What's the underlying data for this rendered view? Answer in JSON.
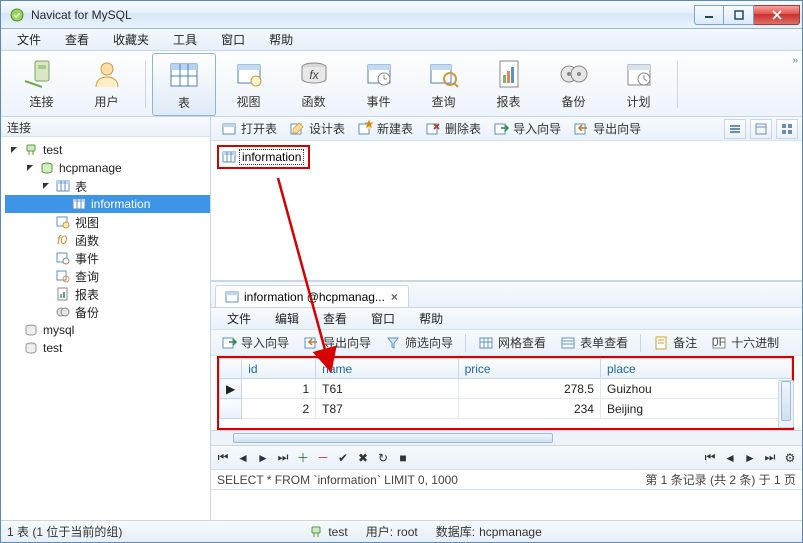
{
  "window": {
    "title": "Navicat for MySQL"
  },
  "menu": {
    "items": [
      "文件",
      "查看",
      "收藏夹",
      "工具",
      "窗口",
      "帮助"
    ]
  },
  "main_toolbar": {
    "items": [
      {
        "id": "connect",
        "label": "连接"
      },
      {
        "id": "user",
        "label": "用户"
      },
      {
        "id": "table",
        "label": "表",
        "selected": true
      },
      {
        "id": "view",
        "label": "视图"
      },
      {
        "id": "function",
        "label": "函数"
      },
      {
        "id": "event",
        "label": "事件"
      },
      {
        "id": "query",
        "label": "查询"
      },
      {
        "id": "report",
        "label": "报表"
      },
      {
        "id": "backup",
        "label": "备份"
      },
      {
        "id": "schedule",
        "label": "计划"
      }
    ]
  },
  "conn_panel": {
    "header": "连接"
  },
  "tree": {
    "nodes": [
      {
        "depth": 0,
        "arrow": "open",
        "icon": "plug-green",
        "label": "test"
      },
      {
        "depth": 1,
        "arrow": "open",
        "icon": "db-green",
        "label": "hcpmanage"
      },
      {
        "depth": 2,
        "arrow": "open",
        "icon": "table",
        "label": "表"
      },
      {
        "depth": 3,
        "arrow": "none",
        "icon": "table",
        "label": "information",
        "selected": true
      },
      {
        "depth": 2,
        "arrow": "none",
        "icon": "view",
        "label": "视图"
      },
      {
        "depth": 2,
        "arrow": "none",
        "icon": "fn",
        "label": "函数"
      },
      {
        "depth": 2,
        "arrow": "none",
        "icon": "event",
        "label": "事件"
      },
      {
        "depth": 2,
        "arrow": "none",
        "icon": "query",
        "label": "查询"
      },
      {
        "depth": 2,
        "arrow": "none",
        "icon": "report",
        "label": "报表"
      },
      {
        "depth": 2,
        "arrow": "none",
        "icon": "backup",
        "label": "备份"
      },
      {
        "depth": 0,
        "arrow": "none",
        "icon": "db-gray",
        "label": "mysql"
      },
      {
        "depth": 0,
        "arrow": "none",
        "icon": "db-gray",
        "label": "test"
      }
    ]
  },
  "obj_toolbar": {
    "btns": [
      {
        "id": "open",
        "label": "打开表"
      },
      {
        "id": "design",
        "label": "设计表"
      },
      {
        "id": "new",
        "label": "新建表"
      },
      {
        "id": "delete",
        "label": "删除表"
      },
      {
        "id": "import",
        "label": "导入向导"
      },
      {
        "id": "export",
        "label": "导出向导"
      }
    ]
  },
  "obj_item": {
    "label": "information"
  },
  "data_tab": {
    "title": "information @hcpmanag..."
  },
  "data_menu": {
    "items": [
      "文件",
      "编辑",
      "查看",
      "窗口",
      "帮助"
    ]
  },
  "data_toolbar": {
    "btns": [
      {
        "id": "import",
        "label": "导入向导"
      },
      {
        "id": "export",
        "label": "导出向导"
      },
      {
        "id": "filter",
        "label": "筛选向导"
      },
      {
        "id": "grid",
        "label": "网格查看"
      },
      {
        "id": "form",
        "label": "表单查看"
      },
      {
        "id": "memo",
        "label": "备注"
      },
      {
        "id": "hex",
        "label": "十六进制"
      }
    ]
  },
  "grid": {
    "columns": [
      "id",
      "name",
      "price",
      "place"
    ],
    "rows": [
      {
        "cursor": true,
        "cells": [
          "1",
          "T61",
          "278.5",
          "Guizhou"
        ]
      },
      {
        "cursor": false,
        "cells": [
          "2",
          "T87",
          "234",
          "Beijing"
        ]
      }
    ]
  },
  "sql_bar": {
    "sql": "SELECT * FROM `information` LIMIT 0, 1000",
    "info": "第 1 条记录 (共 2 条) 于 1 页"
  },
  "status": {
    "left": "1 表 (1 位于当前的组)",
    "conn": "test",
    "userL": "用户:",
    "user": "root",
    "dbL": "数据库:",
    "db": "hcpmanage"
  }
}
